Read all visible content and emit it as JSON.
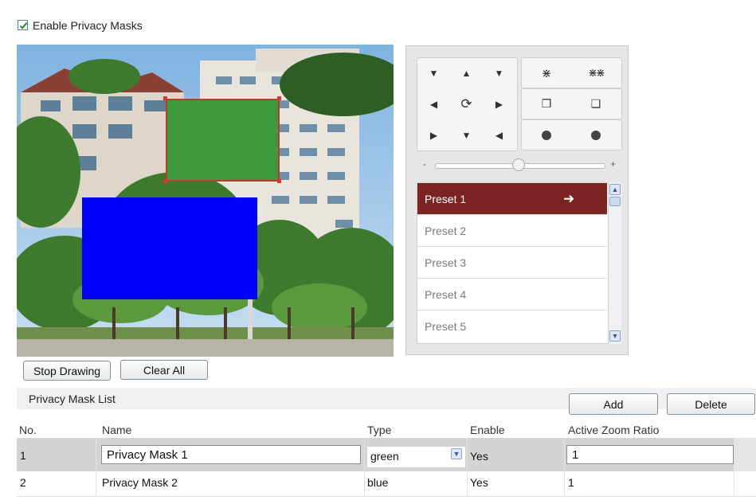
{
  "privacy": {
    "enable_label": "Enable Privacy Masks",
    "enabled": true
  },
  "preview": {
    "masks": [
      {
        "color_name": "green",
        "fill": "#3c9a3c",
        "outline": "#c0392b"
      },
      {
        "color_name": "blue",
        "fill": "#0000fe"
      }
    ]
  },
  "ptz": {
    "directions": [
      "up-left",
      "up",
      "up-right",
      "left",
      "auto-rotate",
      "right",
      "down-left",
      "down",
      "down-right"
    ],
    "zoom_icons": [
      "zoom-in-icon",
      "zoom-out-icon"
    ],
    "focus_icons": [
      "focus-near-icon",
      "focus-far-icon"
    ],
    "iris_icons": [
      "iris-open-icon",
      "iris-close-icon"
    ],
    "speed_minus": "-",
    "speed_plus": "+",
    "presets": [
      "Preset 1",
      "Preset 2",
      "Preset 3",
      "Preset 4",
      "Preset 5"
    ],
    "selected_preset": "Preset 1"
  },
  "drawing": {
    "stop_label": "Stop Drawing",
    "clear_label": "Clear All"
  },
  "list": {
    "title": "Privacy Mask List",
    "add_label": "Add",
    "delete_label": "Delete",
    "columns": [
      "No.",
      "Name",
      "Type",
      "Enable",
      "Active Zoom Ratio"
    ],
    "rows": [
      {
        "no": "1",
        "name": "Privacy Mask 1",
        "type": "green",
        "enable": "Yes",
        "zoom": "1"
      },
      {
        "no": "2",
        "name": "Privacy Mask 2",
        "type": "blue",
        "enable": "Yes",
        "zoom": "1"
      }
    ]
  },
  "colors": {
    "selected_preset_bg": "#7b2323",
    "accent_border": "#7d8fa8"
  }
}
